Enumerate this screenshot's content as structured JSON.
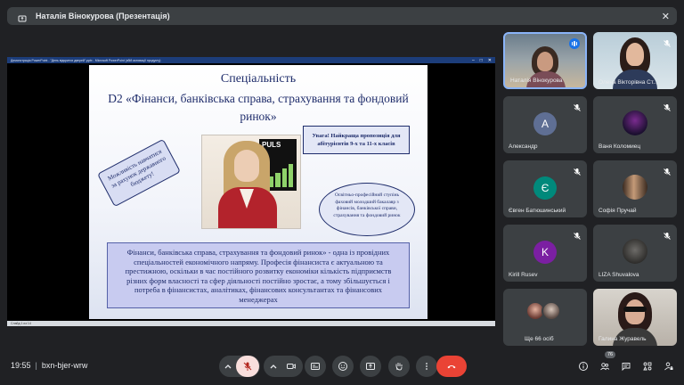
{
  "topbar": {
    "title": "Наталія Вінокурова (Презентація)"
  },
  "presentation": {
    "window_title": "Демонстрація PowerPoint - \"День відкритих дверей\".pptx - Microsoft PowerPoint (збій активації продукту)",
    "status": "Слайд 1 из 14",
    "slide": {
      "heading1": "Спеціальність",
      "heading2": "D2 «Фінанси, банківська справа, страхування  та фондовий ринок»",
      "attention": "Увага! Найкраща пропозиція для абітурієнтів 9-х та 11-х класів",
      "budget": "Можливість навчатися за рахунок державного бюджету!",
      "degree": "Освітньо-професійний ступінь фаховий молодший бакалавр з фінансів, банківської справи, страхування та фондовий ринок",
      "photo_label": "PULS",
      "body": "Фінанси, банківська справа, страхування та фондовий ринок» - одна із провідних спеціальностей економічного напряму. Професія фінансиста є актуальною та престижною, оскільки в час постійного розвитку економіки кількість підприємств різних форм власності та сфер діяльності постійно зростає, а тому збільшується  і потреба в фінансистах, аналітиках, фінансових консультантах та фінансових менеджерах"
    }
  },
  "participants": [
    {
      "name": "Наталія Вінокурова",
      "type": "video"
    },
    {
      "name": "Олена Вікторівна Ст...",
      "type": "video"
    },
    {
      "name": "Александр",
      "initial": "А",
      "color": "#5f6f94"
    },
    {
      "name": "Ваня Коломиец",
      "type": "photo"
    },
    {
      "name": "Євген Батюшинський",
      "initial": "Є",
      "color": "#00897b"
    },
    {
      "name": "Софія Пручай",
      "type": "photo"
    },
    {
      "name": "Kirill Rusev",
      "initial": "K",
      "color": "#7b1fa2"
    },
    {
      "name": "LIZA Shuvalova",
      "type": "photo"
    },
    {
      "name": "Ще 66 осіб"
    },
    {
      "name": "Галина Журавель",
      "type": "video"
    }
  ],
  "bottom": {
    "time": "19:55",
    "meeting_code": "bxn-bjer-wrw",
    "participant_count": "76"
  },
  "colors": {
    "end_call": "#ea4335",
    "background": "#202124",
    "tile": "#3c4043"
  }
}
